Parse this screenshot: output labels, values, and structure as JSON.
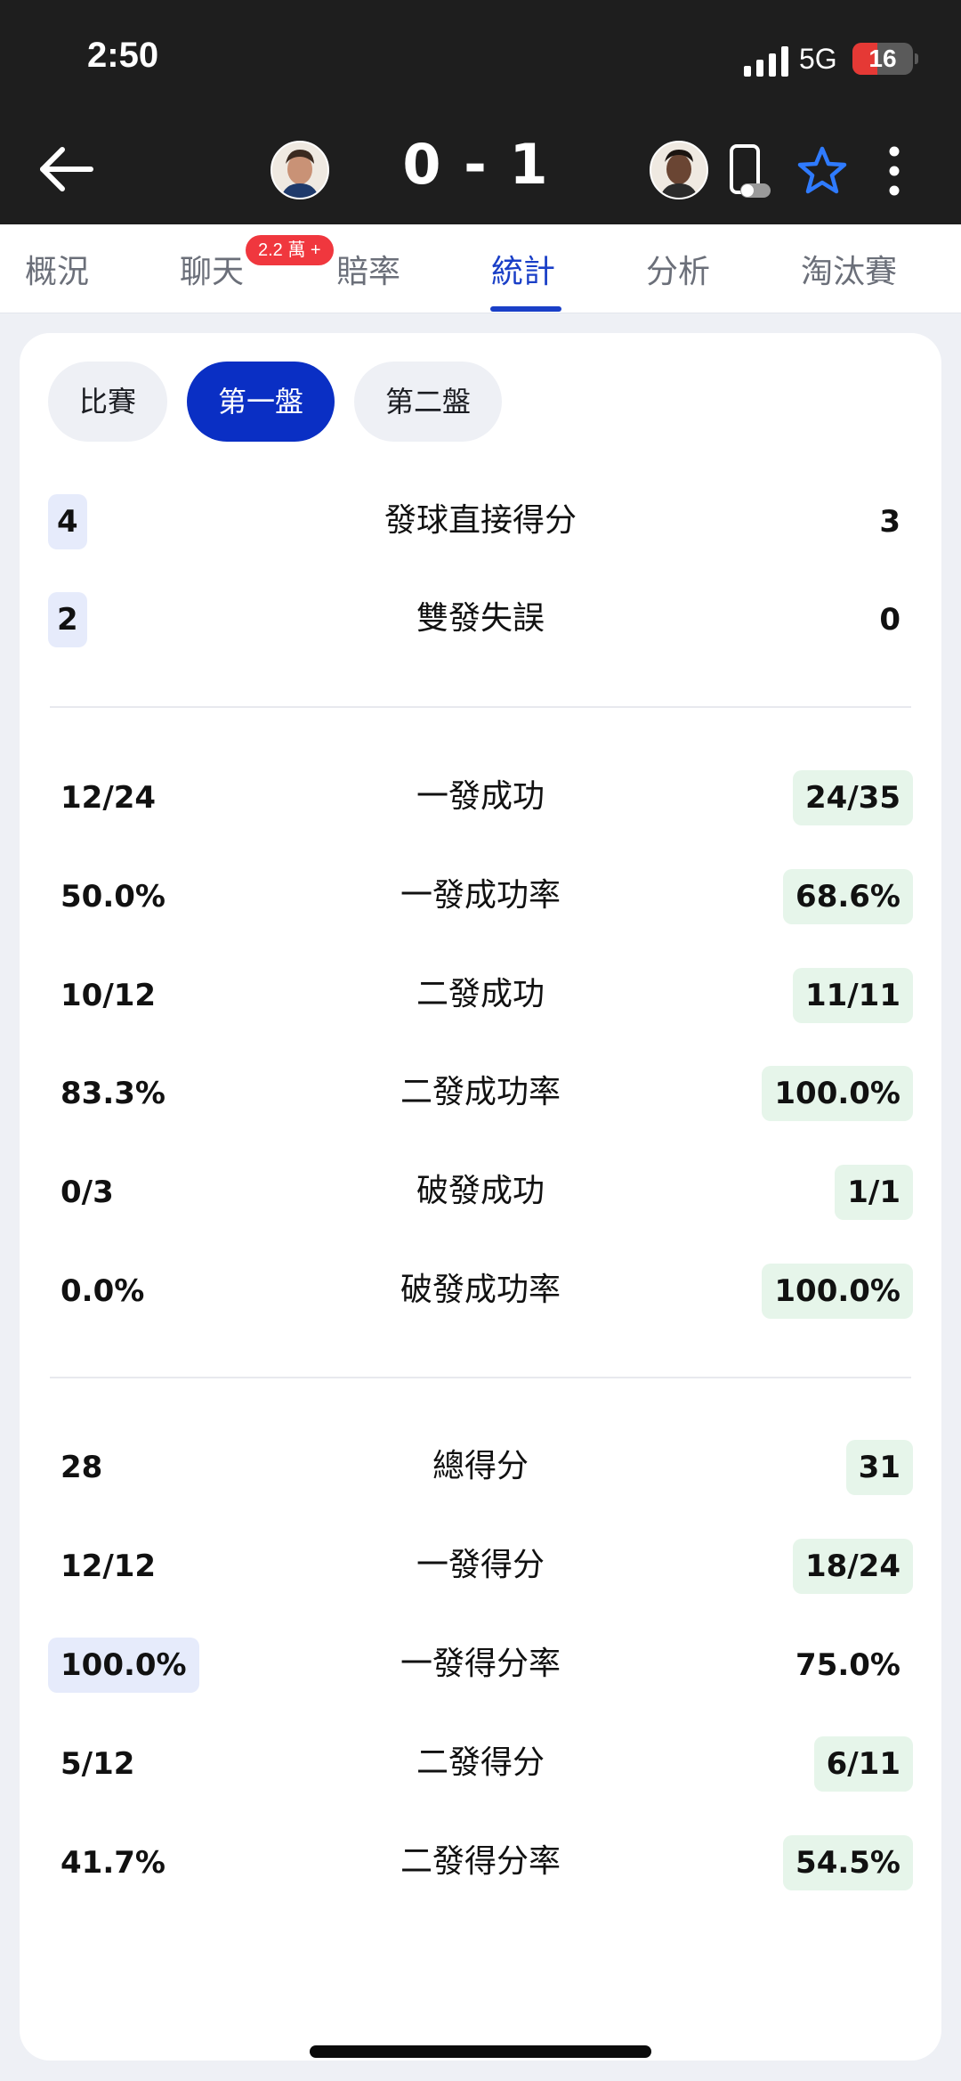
{
  "status_bar": {
    "time": "2:50",
    "network": "5G",
    "battery": "16",
    "battery_level": 0.16
  },
  "header": {
    "score": "0 - 1"
  },
  "tabs": [
    {
      "label": "概況"
    },
    {
      "label": "聊天"
    },
    {
      "label": "賠率"
    },
    {
      "label": "統計"
    },
    {
      "label": "分析"
    },
    {
      "label": "淘汰賽"
    }
  ],
  "chat_badge": "2.2 萬 +",
  "set_filters": [
    {
      "label": "比賽"
    },
    {
      "label": "第一盤"
    },
    {
      "label": "第二盤"
    }
  ],
  "stats": [
    {
      "label": "發球直接得分",
      "left": "4",
      "right": "3"
    },
    {
      "label": "雙發失誤",
      "left": "2",
      "right": "0"
    },
    {
      "label": "一發成功",
      "left": "12/24",
      "right": "24/35"
    },
    {
      "label": "一發成功率",
      "left": "50.0%",
      "right": "68.6%"
    },
    {
      "label": "二發成功",
      "left": "10/12",
      "right": "11/11"
    },
    {
      "label": "二發成功率",
      "left": "83.3%",
      "right": "100.0%"
    },
    {
      "label": "破發成功",
      "left": "0/3",
      "right": "1/1"
    },
    {
      "label": "破發成功率",
      "left": "0.0%",
      "right": "100.0%"
    },
    {
      "label": "總得分",
      "left": "28",
      "right": "31"
    },
    {
      "label": "一發得分",
      "left": "12/12",
      "right": "18/24"
    },
    {
      "label": "一發得分率",
      "left": "100.0%",
      "right": "75.0%"
    },
    {
      "label": "二發得分",
      "left": "5/12",
      "right": "6/11"
    },
    {
      "label": "二發得分率",
      "left": "41.7%",
      "right": "54.5%"
    }
  ],
  "colors": {
    "accent_blue": "#1a3fc7",
    "active_pill": "#0a2fc4",
    "home_highlight": "#e6ebfb",
    "away_highlight": "#e6f5ea",
    "badge_red": "#f0373e"
  }
}
